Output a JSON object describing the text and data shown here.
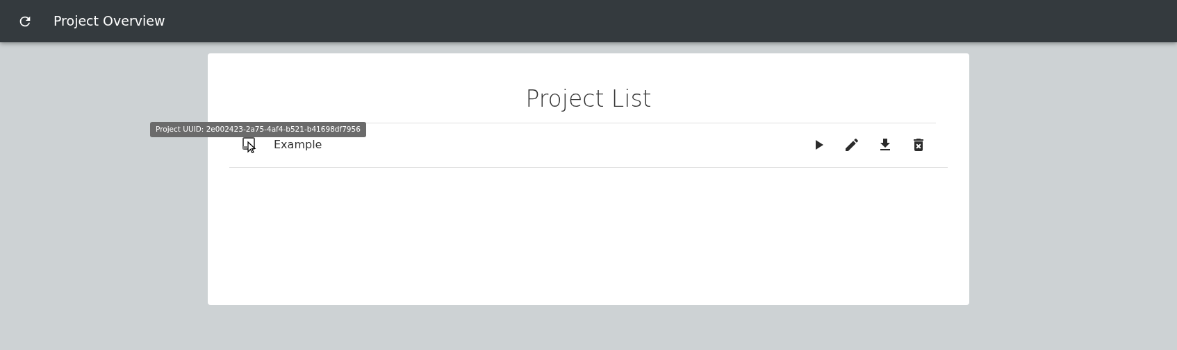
{
  "navbar": {
    "title": "Project Overview"
  },
  "heading": "Project List",
  "tooltip": {
    "text": "Project UUID: 2e002423-2a75-4af4-b521-b41698df7956"
  },
  "projects": [
    {
      "name": "Example",
      "actions": [
        {
          "kind": "play"
        },
        {
          "kind": "edit"
        },
        {
          "kind": "download"
        },
        {
          "kind": "delete"
        }
      ]
    }
  ]
}
